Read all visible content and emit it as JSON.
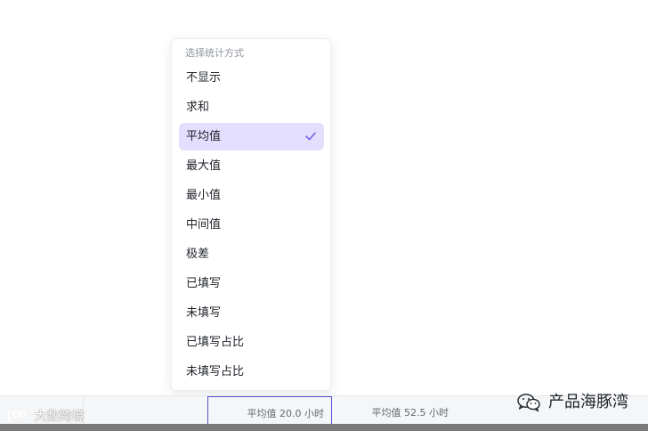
{
  "menu": {
    "header": "选择统计方式",
    "items": [
      {
        "label": "不显示",
        "selected": false
      },
      {
        "label": "求和",
        "selected": false
      },
      {
        "label": "平均值",
        "selected": true
      },
      {
        "label": "最大值",
        "selected": false
      },
      {
        "label": "最小值",
        "selected": false
      },
      {
        "label": "中间值",
        "selected": false
      },
      {
        "label": "极差",
        "selected": false
      },
      {
        "label": "已填写",
        "selected": false
      },
      {
        "label": "未填写",
        "selected": false
      },
      {
        "label": "已填写占比",
        "selected": false
      },
      {
        "label": "未填写占比",
        "selected": false
      }
    ],
    "selected_icon": "check-icon",
    "accent_color": "#6b5ce7",
    "selected_bg": "#e3defe"
  },
  "stat_bar": {
    "cells": [
      {
        "text": "平均值 20.0 小时",
        "active": true
      },
      {
        "text": "平均值 52.5 小时",
        "active": false
      }
    ],
    "active_border_color": "#5b4fd6"
  },
  "watermarks": {
    "left": "大数跨境",
    "right": "产品海豚湾",
    "right_icon": "wechat-icon"
  }
}
